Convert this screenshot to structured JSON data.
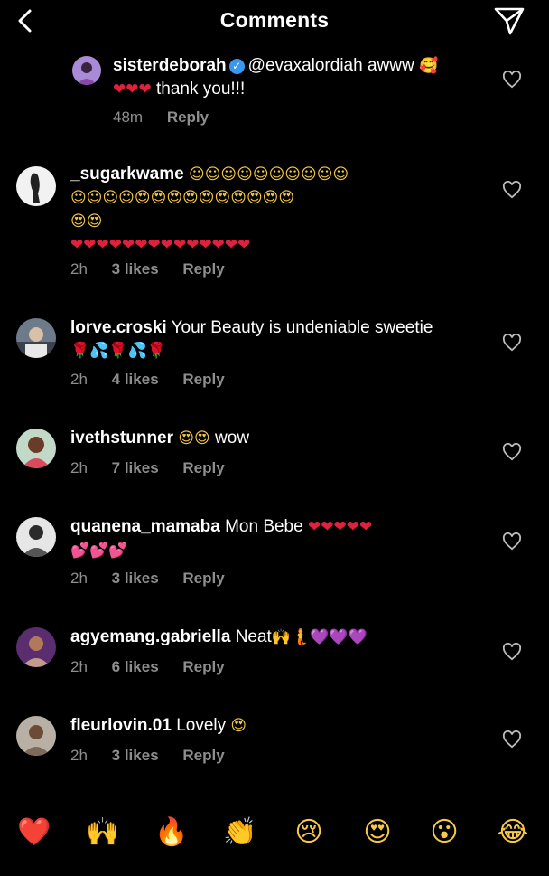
{
  "header": {
    "title": "Comments"
  },
  "colors": {
    "heart_red": "#e0213b",
    "heart_pink": "#ff4fc8",
    "heart_purple": "#9b4dff",
    "muted": "#8e8e8e",
    "verified": "#3897f0"
  },
  "comments": [
    {
      "user": "sisterdeborah",
      "verified": true,
      "body1": "@evaxalordiah awww",
      "emoji1": "🥰",
      "emoji2": "❤❤❤",
      "body2": "thank you!!!",
      "time": "48m",
      "reply": "Reply"
    },
    {
      "user": "_sugarkwame",
      "line1": "☺☺☺☺☺☺☺☺☺☺",
      "line2": "☺☺☺☺😍😍😍😍😍😍😍😍😍😍",
      "line3": "😍😍",
      "line4": "❤❤❤❤❤❤❤❤❤❤❤❤❤❤",
      "time": "2h",
      "likes": "3 likes",
      "reply": "Reply"
    },
    {
      "user": "lorve.croski",
      "body": "Your Beauty is undeniable sweetie",
      "emoji": "🌹💦🌹💦🌹",
      "time": "2h",
      "likes": "4 likes",
      "reply": "Reply"
    },
    {
      "user": "ivethstunner",
      "emoji": "😍😍",
      "body": "wow",
      "time": "2h",
      "likes": "7 likes",
      "reply": "Reply"
    },
    {
      "user": "quanena_mamaba",
      "body": "Mon Bebe",
      "emoji1": "❤❤❤❤❤",
      "emoji2": "💕💕💕",
      "time": "2h",
      "likes": "3 likes",
      "reply": "Reply"
    },
    {
      "user": "agyemang.gabriella",
      "body": "Neat",
      "emoji": "🙌🧜💜💜💜",
      "time": "2h",
      "likes": "6 likes",
      "reply": "Reply"
    },
    {
      "user": "fleurlovin.01",
      "body": "Lovely",
      "emoji": "😍",
      "time": "2h",
      "likes": "3 likes",
      "reply": "Reply"
    }
  ],
  "quick_emojis": [
    "❤️",
    "🙌",
    "🔥",
    "👏",
    "😢",
    "😍",
    "😮",
    "😂"
  ]
}
